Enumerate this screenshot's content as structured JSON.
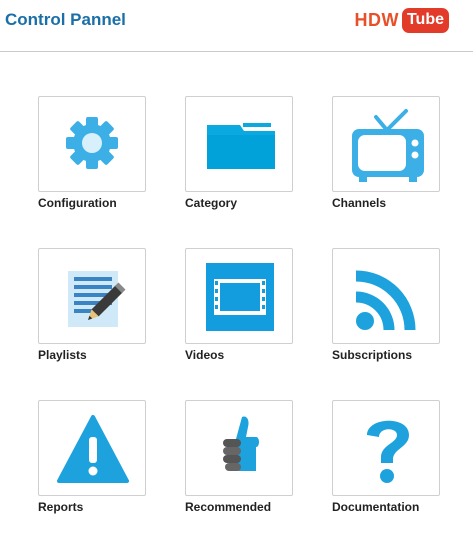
{
  "header": {
    "title": "Control Pannel",
    "logo": {
      "part1": "HDW",
      "part2": "Tube"
    }
  },
  "colors": {
    "accent": "#1a6fa8",
    "icon_blue": "#3cb0e6",
    "logo_red": "#e33b2a"
  },
  "tiles": [
    {
      "label": "Configuration",
      "icon": "gear-icon"
    },
    {
      "label": "Category",
      "icon": "folder-icon"
    },
    {
      "label": "Channels",
      "icon": "tv-icon"
    },
    {
      "label": "Playlists",
      "icon": "document-pencil-icon"
    },
    {
      "label": "Videos",
      "icon": "film-icon"
    },
    {
      "label": "Subscriptions",
      "icon": "rss-icon"
    },
    {
      "label": "Reports",
      "icon": "warning-icon"
    },
    {
      "label": "Recommended",
      "icon": "thumbs-up-icon"
    },
    {
      "label": "Documentation",
      "icon": "question-icon"
    }
  ]
}
